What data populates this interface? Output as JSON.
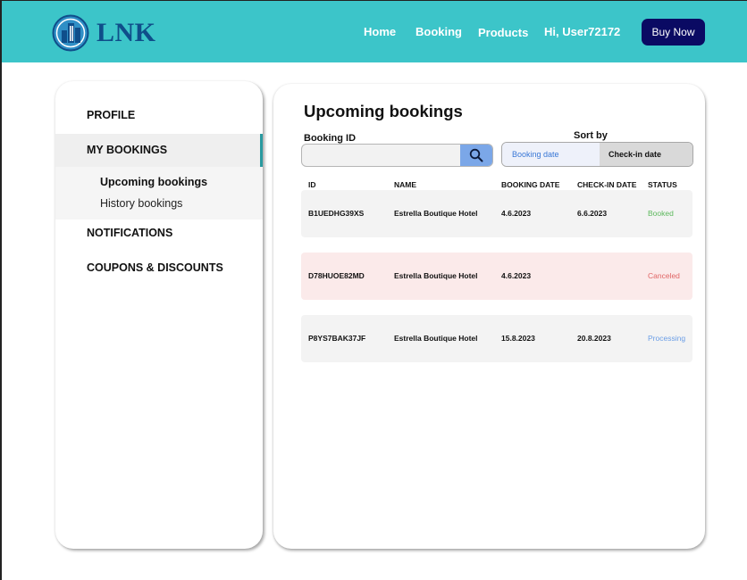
{
  "header": {
    "logo_text": "LNK",
    "nav": {
      "home": "Home",
      "booking": "Booking",
      "products": "Products"
    },
    "greeting": "Hi, User72172",
    "buy_label": "Buy Now"
  },
  "sidebar": {
    "profile": "PROFILE",
    "my_bookings": "MY BOOKINGS",
    "upcoming": "Upcoming bookings",
    "history": "History bookings",
    "notifications": "NOTIFICATIONS",
    "coupons": "COUPONS & DISCOUNTS"
  },
  "main": {
    "title": "Upcoming bookings",
    "booking_id_label": "Booking ID",
    "search_value": "",
    "sort_by_label": "Sort by",
    "sort_options": [
      "Booking date",
      "Check-in date"
    ],
    "columns": [
      "ID",
      "NAME",
      "BOOKING DATE",
      "CHECK-IN DATE",
      "STATUS"
    ],
    "rows": [
      {
        "id": "B1UEDHG39XS",
        "name": "Estrella Boutique Hotel",
        "booking_date": "4.6.2023",
        "checkin_date": "6.6.2023",
        "status": "Booked"
      },
      {
        "id": "D78HUOE82MD",
        "name": "Estrella Boutique Hotel",
        "booking_date": "4.6.2023",
        "checkin_date": "",
        "status": "Canceled"
      },
      {
        "id": "P8YS7BAK37JF",
        "name": "Estrella Boutique Hotel",
        "booking_date": "15.8.2023",
        "checkin_date": "20.8.2023",
        "status": "Processing"
      }
    ]
  },
  "colors": {
    "header_bg": "#3cc5c9",
    "buy_bg": "#0a0a63",
    "status_booked": "#5cb85c",
    "status_canceled": "#e06666",
    "status_processing": "#6b9ee6",
    "canceled_row_bg": "#fbeaea",
    "accent": "#2a9aa0"
  },
  "icons": {
    "logo": "building-logo-icon",
    "search": "search-icon"
  }
}
